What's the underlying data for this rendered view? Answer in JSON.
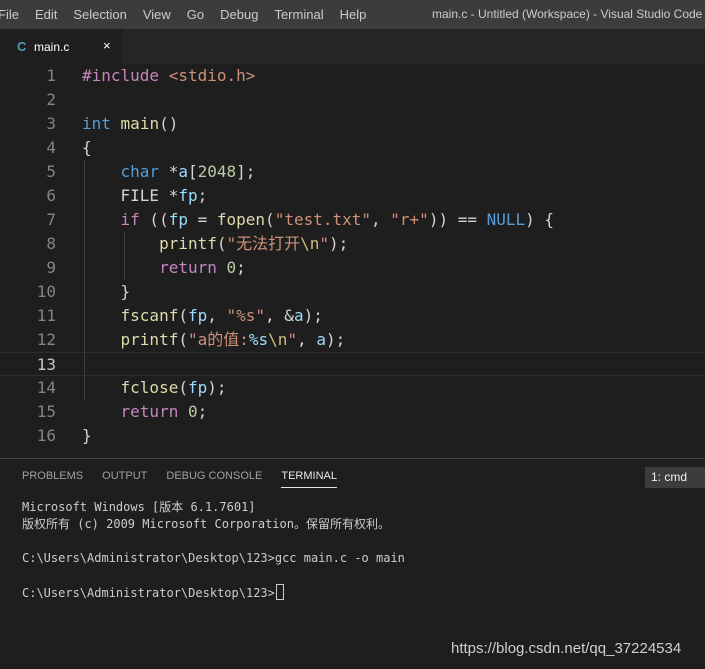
{
  "menu": [
    "File",
    "Edit",
    "Selection",
    "View",
    "Go",
    "Debug",
    "Terminal",
    "Help"
  ],
  "window_title": "main.c - Untitled (Workspace) - Visual Studio Code",
  "tab": {
    "icon": "C",
    "label": "main.c",
    "close": "×"
  },
  "code_lines": [
    {
      "num": "1",
      "tokens": [
        [
          "#include ",
          "#c586c0"
        ],
        [
          "<stdio.h>",
          "#ce9178"
        ]
      ]
    },
    {
      "num": "2",
      "tokens": []
    },
    {
      "num": "3",
      "tokens": [
        [
          "int",
          "#569cd6"
        ],
        [
          " ",
          "#d4d4d4"
        ],
        [
          "main",
          "#dcdcaa"
        ],
        [
          "()",
          "#d4d4d4"
        ]
      ]
    },
    {
      "num": "4",
      "tokens": [
        [
          "{",
          "#d4d4d4"
        ]
      ]
    },
    {
      "num": "5",
      "tokens": [
        [
          "    ",
          "#d4d4d4"
        ],
        [
          "char",
          "#569cd6"
        ],
        [
          " *",
          "#d4d4d4"
        ],
        [
          "a",
          "#9cdcfe"
        ],
        [
          "[",
          "#d4d4d4"
        ],
        [
          "2048",
          "#b5cea8"
        ],
        [
          "];",
          "#d4d4d4"
        ]
      ]
    },
    {
      "num": "6",
      "tokens": [
        [
          "    ",
          "#d4d4d4"
        ],
        [
          "FILE",
          "#d4d4d4"
        ],
        [
          " *",
          "#d4d4d4"
        ],
        [
          "fp",
          "#9cdcfe"
        ],
        [
          ";",
          "#d4d4d4"
        ]
      ]
    },
    {
      "num": "7",
      "tokens": [
        [
          "    ",
          "#d4d4d4"
        ],
        [
          "if",
          "#c586c0"
        ],
        [
          " ((",
          "#d4d4d4"
        ],
        [
          "fp",
          "#9cdcfe"
        ],
        [
          " = ",
          "#d4d4d4"
        ],
        [
          "fopen",
          "#dcdcaa"
        ],
        [
          "(",
          "#d4d4d4"
        ],
        [
          "\"test.txt\"",
          "#ce9178"
        ],
        [
          ", ",
          "#d4d4d4"
        ],
        [
          "\"r+\"",
          "#ce9178"
        ],
        [
          ")) == ",
          "#d4d4d4"
        ],
        [
          "NULL",
          "#569cd6"
        ],
        [
          ") {",
          "#d4d4d4"
        ]
      ]
    },
    {
      "num": "8",
      "tokens": [
        [
          "        ",
          "#d4d4d4"
        ],
        [
          "printf",
          "#dcdcaa"
        ],
        [
          "(",
          "#d4d4d4"
        ],
        [
          "\"无法打开",
          "#ce9178"
        ],
        [
          "\\n",
          "#d7ba7d"
        ],
        [
          "\"",
          "#ce9178"
        ],
        [
          ");",
          "#d4d4d4"
        ]
      ]
    },
    {
      "num": "9",
      "tokens": [
        [
          "        ",
          "#d4d4d4"
        ],
        [
          "return",
          "#c586c0"
        ],
        [
          " ",
          "#d4d4d4"
        ],
        [
          "0",
          "#b5cea8"
        ],
        [
          ";",
          "#d4d4d4"
        ]
      ]
    },
    {
      "num": "10",
      "tokens": [
        [
          "    ",
          "#d4d4d4"
        ],
        [
          "}",
          "#d4d4d4"
        ]
      ]
    },
    {
      "num": "11",
      "tokens": [
        [
          "    ",
          "#d4d4d4"
        ],
        [
          "fscanf",
          "#dcdcaa"
        ],
        [
          "(",
          "#d4d4d4"
        ],
        [
          "fp",
          "#9cdcfe"
        ],
        [
          ", ",
          "#d4d4d4"
        ],
        [
          "\"%s\"",
          "#ce9178"
        ],
        [
          ", &",
          "#d4d4d4"
        ],
        [
          "a",
          "#9cdcfe"
        ],
        [
          ");",
          "#d4d4d4"
        ]
      ]
    },
    {
      "num": "12",
      "tokens": [
        [
          "    ",
          "#d4d4d4"
        ],
        [
          "printf",
          "#dcdcaa"
        ],
        [
          "(",
          "#d4d4d4"
        ],
        [
          "\"a的值:",
          "#ce9178"
        ],
        [
          "%s",
          "#9cdcfe"
        ],
        [
          "\\n",
          "#d7ba7d"
        ],
        [
          "\"",
          "#ce9178"
        ],
        [
          ", ",
          "#d4d4d4"
        ],
        [
          "a",
          "#9cdcfe"
        ],
        [
          ");",
          "#d4d4d4"
        ]
      ]
    },
    {
      "num": "13",
      "tokens": []
    },
    {
      "num": "14",
      "tokens": [
        [
          "    ",
          "#d4d4d4"
        ],
        [
          "fclose",
          "#dcdcaa"
        ],
        [
          "(",
          "#d4d4d4"
        ],
        [
          "fp",
          "#9cdcfe"
        ],
        [
          ");",
          "#d4d4d4"
        ]
      ]
    },
    {
      "num": "15",
      "tokens": [
        [
          "    ",
          "#d4d4d4"
        ],
        [
          "return",
          "#c586c0"
        ],
        [
          " ",
          "#d4d4d4"
        ],
        [
          "0",
          "#b5cea8"
        ],
        [
          ";",
          "#d4d4d4"
        ]
      ]
    },
    {
      "num": "16",
      "tokens": [
        [
          "}",
          "#d4d4d4"
        ]
      ]
    }
  ],
  "current_line": "13",
  "panel": {
    "tabs": [
      "PROBLEMS",
      "OUTPUT",
      "DEBUG CONSOLE",
      "TERMINAL"
    ],
    "active_tab": "TERMINAL",
    "terminal_select": "1: cmd"
  },
  "terminal_lines": [
    "Microsoft Windows [版本 6.1.7601]",
    "版权所有 (c) 2009 Microsoft Corporation。保留所有权利。",
    "",
    "C:\\Users\\Administrator\\Desktop\\123>gcc main.c -o main",
    "",
    "C:\\Users\\Administrator\\Desktop\\123>"
  ],
  "watermark": "https://blog.csdn.net/qq_37224534"
}
